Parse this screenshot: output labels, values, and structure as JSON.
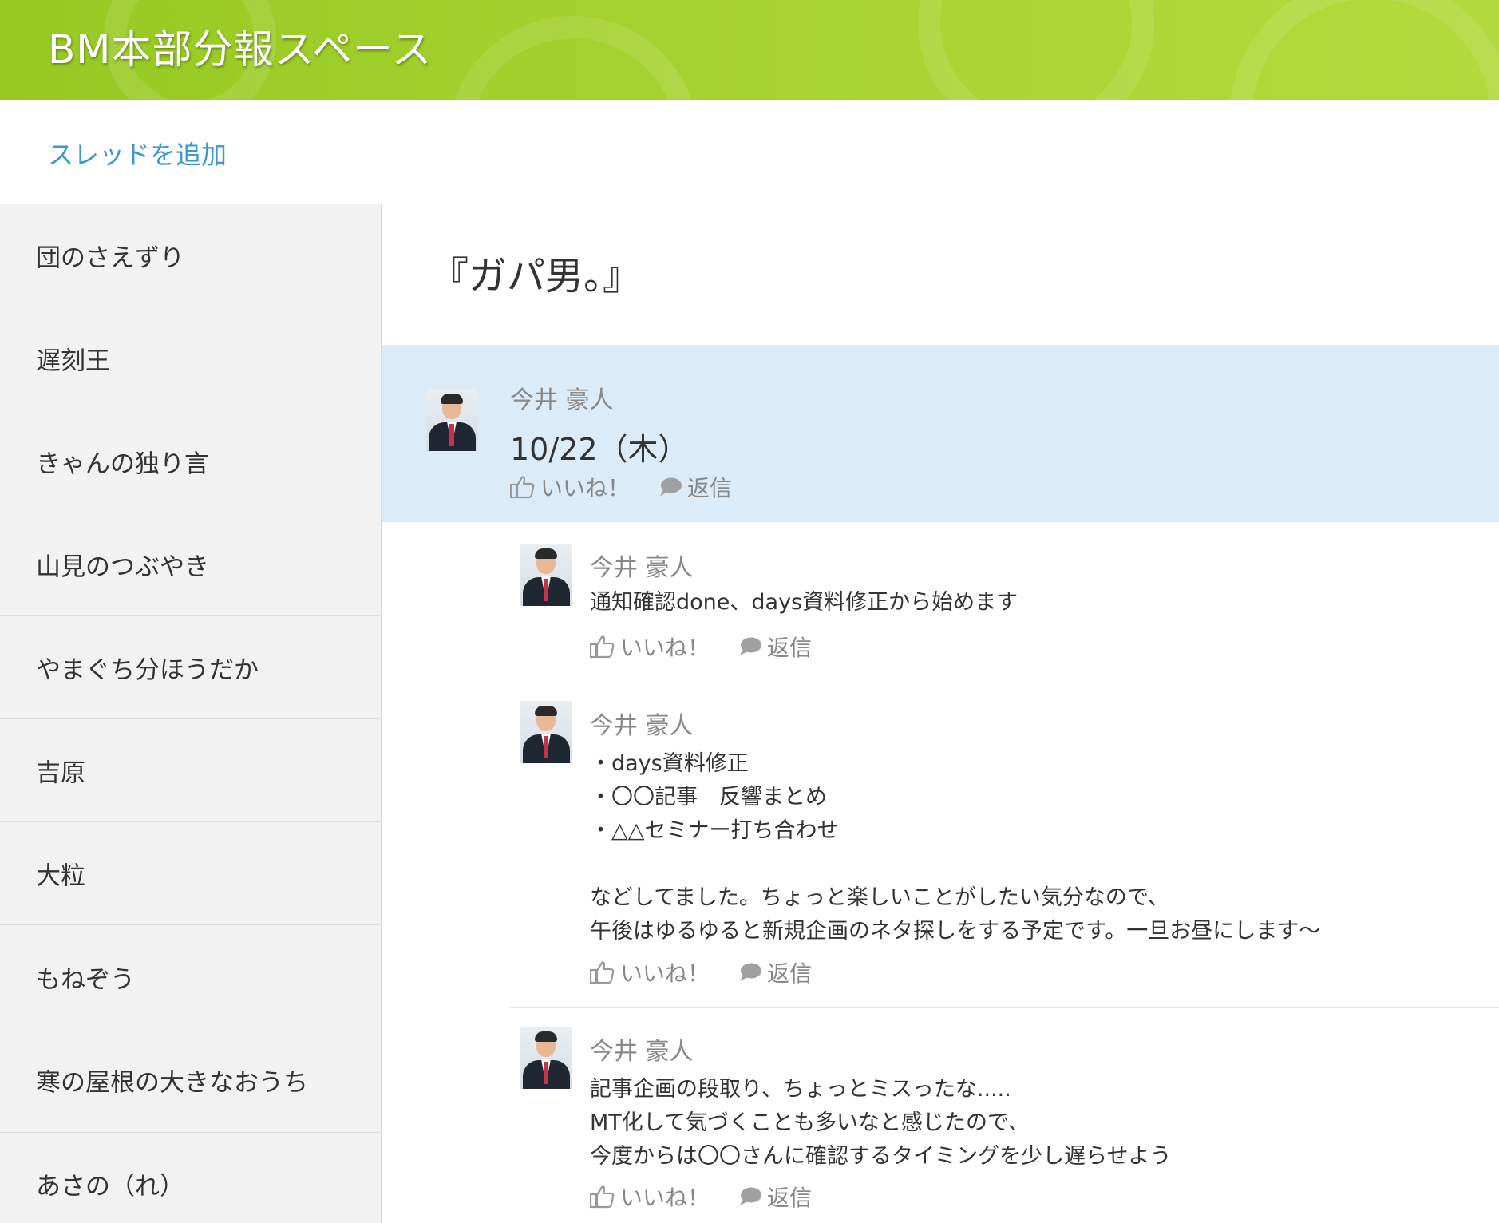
{
  "header": {
    "title": "BM本部分報スペース"
  },
  "toolbar": {
    "add_thread_label": "スレッドを追加"
  },
  "sidebar": {
    "items": [
      {
        "label": "団のさえずり"
      },
      {
        "label": "遅刻王"
      },
      {
        "label": "きゃんの独り言"
      },
      {
        "label": "山見のつぶやき"
      },
      {
        "label": "やまぐち分ほうだか"
      },
      {
        "label": "吉原"
      },
      {
        "label": "大粒"
      },
      {
        "label": "もねぞう"
      },
      {
        "label": "寒の屋根の大きなおうち"
      },
      {
        "label": "あさの（れ）"
      }
    ]
  },
  "thread": {
    "title": "『ガパ男。』",
    "main_post": {
      "author": "今井 豪人",
      "text": "10/22（木）",
      "like_label": "いいね！",
      "reply_label": "返信"
    },
    "replies": [
      {
        "author": "今井 豪人",
        "lines": [
          "通知確認done、days資料修正から始めます"
        ],
        "like_label": "いいね！",
        "reply_label": "返信"
      },
      {
        "author": "今井 豪人",
        "lines": [
          "・days資料修正",
          "・〇〇記事　反響まとめ",
          "・△△セミナー打ち合わせ",
          "",
          "などしてました。ちょっと楽しいことがしたい気分なので、",
          "午後はゆるゆると新規企画のネタ探しをする予定です。一旦お昼にします〜"
        ],
        "like_label": "いいね！",
        "reply_label": "返信"
      },
      {
        "author": "今井 豪人",
        "lines": [
          "記事企画の段取り、ちょっとミスったな.....",
          "MT化して気づくことも多いなと感じたので、",
          "今度からは〇〇さんに確認するタイミングを少し遅らせよう"
        ],
        "like_label": "いいね！",
        "reply_label": "返信"
      }
    ]
  },
  "colors": {
    "header_green": "#a6d22f",
    "link_blue": "#3d97d0",
    "highlight_blue": "#dcebf8",
    "sidebar_bg": "#f2f2f2",
    "muted_text": "#888888"
  },
  "icons": [
    "thumbs-up-icon",
    "speech-bubble-icon",
    "user-avatar"
  ]
}
